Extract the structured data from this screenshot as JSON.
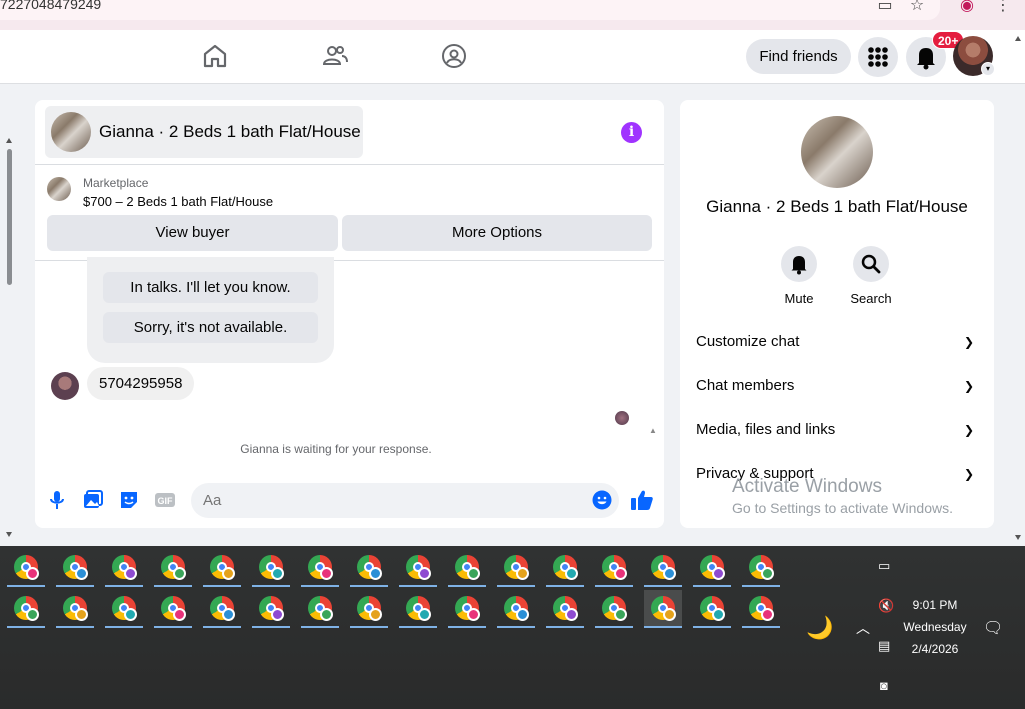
{
  "browser": {
    "url_fragment": "7227048479249"
  },
  "header": {
    "find_friends": "Find friends",
    "notif_count": "20+"
  },
  "chat": {
    "title": "Gianna · 2 Beds 1 bath Flat/House",
    "marketplace_label": "Marketplace",
    "listing": "$700 – 2 Beds 1 bath Flat/House",
    "view_buyer": "View buyer",
    "more_options": "More Options",
    "quick_replies": [
      "In talks. I'll let you know.",
      "Sorry, it's not available."
    ],
    "message": "5704295958",
    "waiting": "Gianna is waiting for your response.",
    "input_placeholder": "Aa",
    "accent": "#0866ff"
  },
  "info": {
    "name": "Gianna · 2 Beds 1 bath Flat/House",
    "mute": "Mute",
    "search": "Search",
    "sections": [
      "Customize chat",
      "Chat members",
      "Media, files and links",
      "Privacy & support"
    ]
  },
  "watermark": {
    "title": "Activate Windows",
    "subtitle": "Go to Settings to activate Windows."
  },
  "taskbar": {
    "time": "9:01 PM",
    "day": "Wednesday",
    "date": "2/4/2026",
    "badge_colors": [
      "#e8327a",
      "#2b8fd6",
      "#8e4bd1",
      "#3aa55a",
      "#e5a21b",
      "#21a9b0"
    ]
  }
}
